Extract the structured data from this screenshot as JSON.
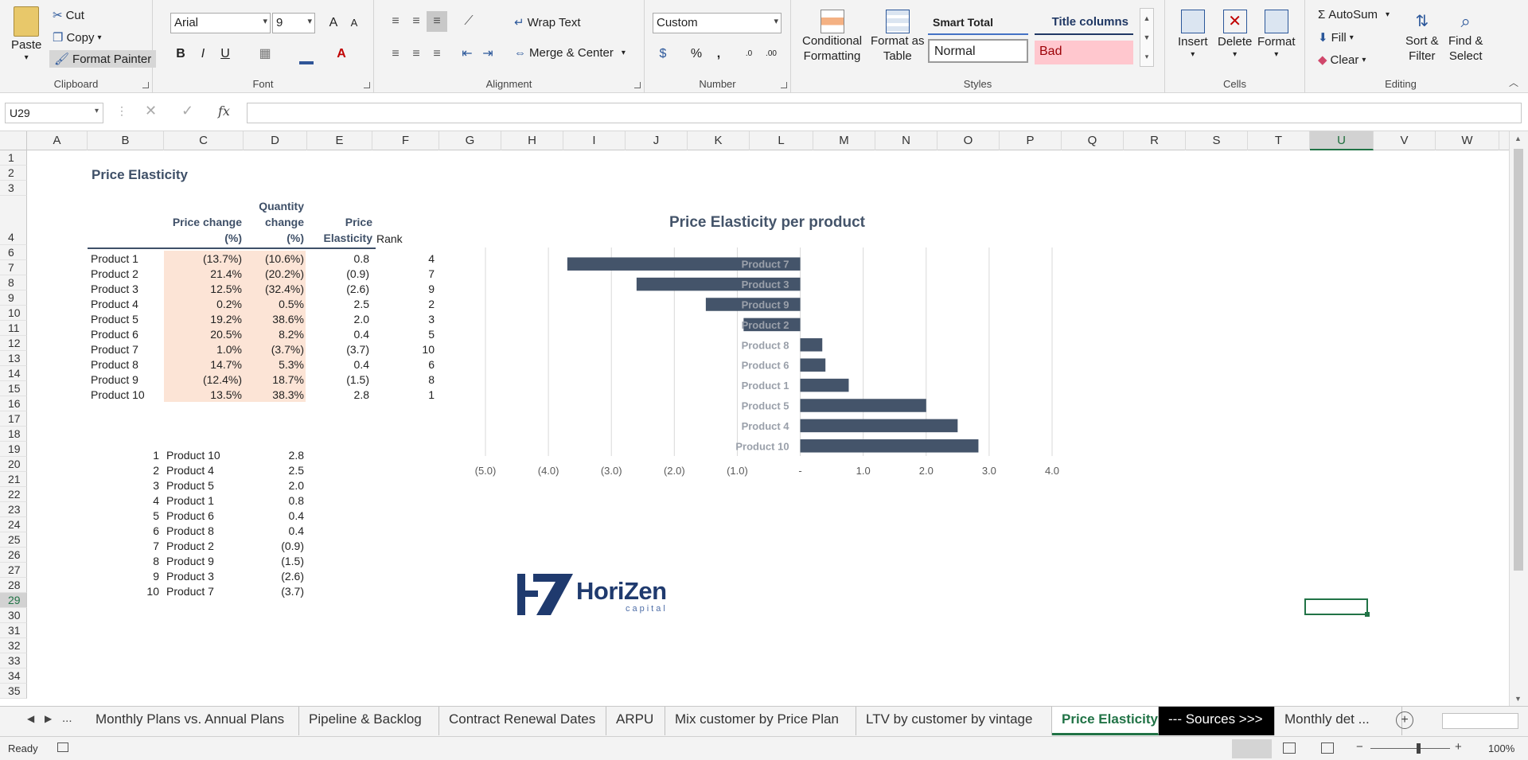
{
  "ribbon": {
    "clipboard": {
      "paste": "Paste",
      "cut": "Cut",
      "copy": "Copy",
      "format_painter": "Format Painter",
      "label": "Clipboard"
    },
    "font": {
      "name": "Arial",
      "size": "9",
      "bold": "B",
      "italic": "I",
      "underline": "U",
      "label": "Font",
      "grow": "A",
      "shrink": "A"
    },
    "alignment": {
      "wrap": "Wrap Text",
      "merge": "Merge & Center",
      "label": "Alignment"
    },
    "number": {
      "format": "Custom",
      "percent": "%",
      "comma": ",",
      "inc": ".0",
      "dec": ".00",
      "label": "Number"
    },
    "styles": {
      "conditional": "Conditional",
      "conditional2": "Formatting",
      "format_table": "Format as",
      "format_table2": "Table",
      "smart_total": "Smart Total",
      "title_columns": "Title columns",
      "normal": "Normal",
      "bad": "Bad",
      "label": "Styles"
    },
    "cells": {
      "insert": "Insert",
      "delete": "Delete",
      "format": "Format",
      "label": "Cells"
    },
    "editing": {
      "autosum": "AutoSum",
      "fill": "Fill",
      "clear": "Clear",
      "sort": "Sort &",
      "sort2": "Filter",
      "find": "Find &",
      "find2": "Select",
      "label": "Editing"
    }
  },
  "formula_bar": {
    "name_box": "U29",
    "fx": "fx",
    "content": ""
  },
  "columns": [
    "A",
    "B",
    "C",
    "D",
    "E",
    "F",
    "G",
    "H",
    "I",
    "J",
    "K",
    "L",
    "M",
    "N",
    "O",
    "P",
    "Q",
    "R",
    "S",
    "T",
    "U",
    "V",
    "W"
  ],
  "selected_column": "U",
  "rows": [
    "1",
    "2",
    "3",
    "4",
    "6",
    "7",
    "8",
    "9",
    "10",
    "11",
    "12",
    "13",
    "14",
    "15",
    "16",
    "17",
    "18",
    "19",
    "20",
    "21",
    "22",
    "23",
    "24",
    "25",
    "26",
    "27",
    "28",
    "29",
    "30",
    "31",
    "32",
    "33",
    "34",
    "35"
  ],
  "selected_row": "29",
  "sheet": {
    "title": "Price Elasticity",
    "headers": {
      "price_change_1": "Price change",
      "price_change_2": "(%)",
      "qty_1": "Quantity",
      "qty_2": "change",
      "qty_3": "(%)",
      "pe_1": "Price",
      "pe_2": "Elasticity",
      "rank": "Rank"
    },
    "table": [
      {
        "product": "Product 1",
        "price": "(13.7%)",
        "qty": "(10.6%)",
        "pe": "0.8",
        "rank": "4"
      },
      {
        "product": "Product 2",
        "price": "21.4%",
        "qty": "(20.2%)",
        "pe": "(0.9)",
        "rank": "7"
      },
      {
        "product": "Product 3",
        "price": "12.5%",
        "qty": "(32.4%)",
        "pe": "(2.6)",
        "rank": "9"
      },
      {
        "product": "Product 4",
        "price": "0.2%",
        "qty": "0.5%",
        "pe": "2.5",
        "rank": "2"
      },
      {
        "product": "Product 5",
        "price": "19.2%",
        "qty": "38.6%",
        "pe": "2.0",
        "rank": "3"
      },
      {
        "product": "Product 6",
        "price": "20.5%",
        "qty": "8.2%",
        "pe": "0.4",
        "rank": "5"
      },
      {
        "product": "Product 7",
        "price": "1.0%",
        "qty": "(3.7%)",
        "pe": "(3.7)",
        "rank": "10"
      },
      {
        "product": "Product 8",
        "price": "14.7%",
        "qty": "5.3%",
        "pe": "0.4",
        "rank": "6"
      },
      {
        "product": "Product 9",
        "price": "(12.4%)",
        "qty": "18.7%",
        "pe": "(1.5)",
        "rank": "8"
      },
      {
        "product": "Product 10",
        "price": "13.5%",
        "qty": "38.3%",
        "pe": "2.8",
        "rank": "1"
      }
    ],
    "ranked": [
      {
        "n": "1",
        "product": "Product 10",
        "pe": "2.8"
      },
      {
        "n": "2",
        "product": "Product 4",
        "pe": "2.5"
      },
      {
        "n": "3",
        "product": "Product 5",
        "pe": "2.0"
      },
      {
        "n": "4",
        "product": "Product 1",
        "pe": "0.8"
      },
      {
        "n": "5",
        "product": "Product 6",
        "pe": "0.4"
      },
      {
        "n": "6",
        "product": "Product 8",
        "pe": "0.4"
      },
      {
        "n": "7",
        "product": "Product 2",
        "pe": "(0.9)"
      },
      {
        "n": "8",
        "product": "Product 9",
        "pe": "(1.5)"
      },
      {
        "n": "9",
        "product": "Product 3",
        "pe": "(2.6)"
      },
      {
        "n": "10",
        "product": "Product 7",
        "pe": "(3.7)"
      }
    ]
  },
  "chart_data": {
    "type": "bar",
    "orientation": "horizontal",
    "title": "Price Elasticity per product",
    "categories": [
      "Product 7",
      "Product 3",
      "Product 9",
      "Product 2",
      "Product 8",
      "Product 6",
      "Product 1",
      "Product 5",
      "Product 4",
      "Product 10"
    ],
    "values": [
      -3.7,
      -2.6,
      -1.5,
      -0.9,
      0.35,
      0.4,
      0.77,
      2.0,
      2.5,
      2.83
    ],
    "xlim": [
      -5,
      4
    ],
    "xticks": [
      "(5.0)",
      "(4.0)",
      "(3.0)",
      "(2.0)",
      "(1.0)",
      "-",
      "1.0",
      "2.0",
      "3.0",
      "4.0"
    ],
    "grid": true,
    "bar_color": "#44546a"
  },
  "logo": {
    "brand": "HoriZen",
    "sub": "capital"
  },
  "tabs": [
    "Monthly Plans vs. Annual Plans",
    "Pipeline & Backlog",
    "Contract Renewal Dates",
    "ARPU",
    "Mix customer by Price Plan",
    "LTV by customer by vintage",
    "Price Elasticity",
    "--- Sources >>>",
    "Monthly det ..."
  ],
  "tab_nav": {
    "more": "..."
  },
  "active_tab": "Price Elasticity",
  "status": {
    "ready": "Ready",
    "zoom": "100%"
  },
  "colors": {
    "accent": "#217346",
    "header_text": "#3f5068",
    "input_fill": "#fce4d6",
    "bad_fill": "#ffc7ce"
  }
}
